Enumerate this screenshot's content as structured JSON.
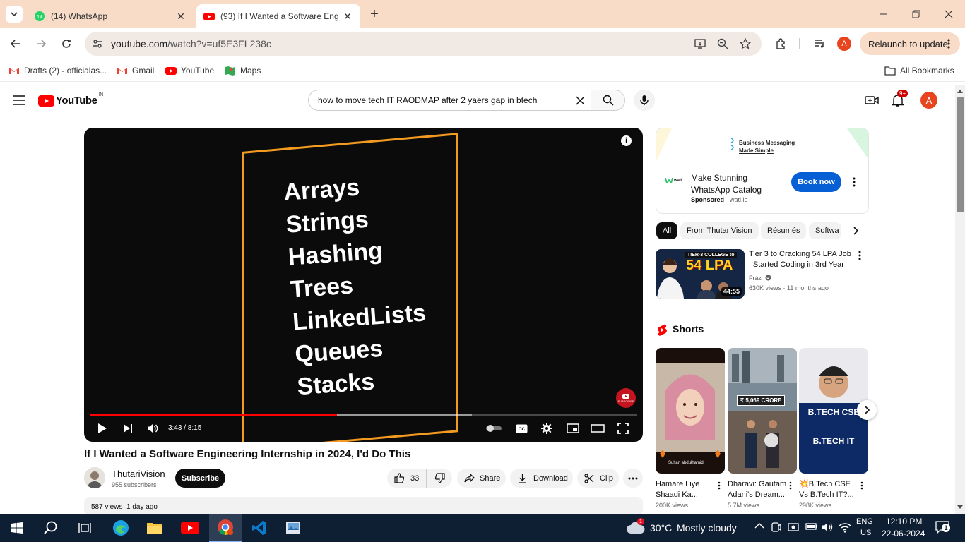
{
  "browser": {
    "tabs": [
      {
        "title": "(14) WhatsApp",
        "badge": "14"
      },
      {
        "title": "(93) If I Wanted a Software Eng"
      }
    ],
    "url_host": "youtube.com",
    "url_path": "/watch?v=uf5E3FL238c",
    "relaunch_label": "Relaunch to update",
    "profile_initial": "A",
    "bookmarks": [
      "Drafts (2) - officialas...",
      "Gmail",
      "YouTube",
      "Maps"
    ],
    "all_bookmarks_label": "All Bookmarks"
  },
  "youtube": {
    "logo_text": "YouTube",
    "region": "IN",
    "search_query": "how to move tech IT RAODMAP after 2 yaers gap in btech",
    "notifications_badge": "9+",
    "avatar_initial": "A"
  },
  "video": {
    "overlay_lines": [
      "Arrays",
      "Strings",
      "Hashing",
      "Trees",
      "LinkedLists",
      "Queues",
      "Stacks"
    ],
    "watermark": "SUBSCRIBE",
    "time_current": "3:43",
    "time_total": "8:15",
    "timecode": "3:43 / 8:15",
    "progress": 0.451,
    "buffered": 0.699,
    "title": "If I Wanted a Software Engineering Internship in 2024, I'd Do This",
    "channel": "ThutariVision",
    "subscribers": "955 subscribers",
    "subscribe_label": "Subscribe",
    "likes": "33",
    "share_label": "Share",
    "download_label": "Download",
    "clip_label": "Clip",
    "views": "587 views",
    "age": "1 day ago"
  },
  "ad": {
    "banner_line1": "Business Messaging",
    "banner_line2": "Made Simple",
    "brand": "wati",
    "headline_line1": "Make Stunning",
    "headline_line2": "WhatsApp Catalog",
    "sponsored": "Sponsored",
    "domain": "wati.io",
    "cta": "Book now"
  },
  "chips": [
    "All",
    "From ThutariVision",
    "Résumés",
    "Softwa"
  ],
  "recommended": {
    "thumb_top": "TIER-3 COLLEGE to",
    "thumb_big": "54 LPA",
    "duration": "44:55",
    "title": "Tier 3 to Cracking 54 LPA Job | Started Coding in 3rd Year |...",
    "channel": "Fraz",
    "views": "630K views",
    "age": "11 months ago"
  },
  "shorts": {
    "heading": "Shorts",
    "items": [
      {
        "title": "Hamare Liye Shaadi Ka...",
        "views": "200K views",
        "caption": "Sultan abdulhamid"
      },
      {
        "title": "Dharavi: Gautam Adani's Dream...",
        "views": "5.7M views",
        "caption": "₹ 5,069 CRORE"
      },
      {
        "title": "💥B.Tech CSE Vs B.Tech IT?...",
        "views": "298K views",
        "caption_top": "B.TECH CSE",
        "caption_bottom": "B.TECH IT"
      }
    ]
  },
  "taskbar": {
    "weather_temp": "30°C",
    "weather_desc": "Mostly cloudy",
    "weather_badge": "1",
    "lang": "ENG",
    "region": "US",
    "time": "12:10 PM",
    "date": "22-06-2024",
    "notif_count": "1"
  },
  "colors": {
    "tabstrip": "#f8dcc8",
    "youtube_red": "#ff0000",
    "video_frame": "#f39a21",
    "cta_blue": "#065fd4",
    "taskbar": "#0f1f33"
  }
}
